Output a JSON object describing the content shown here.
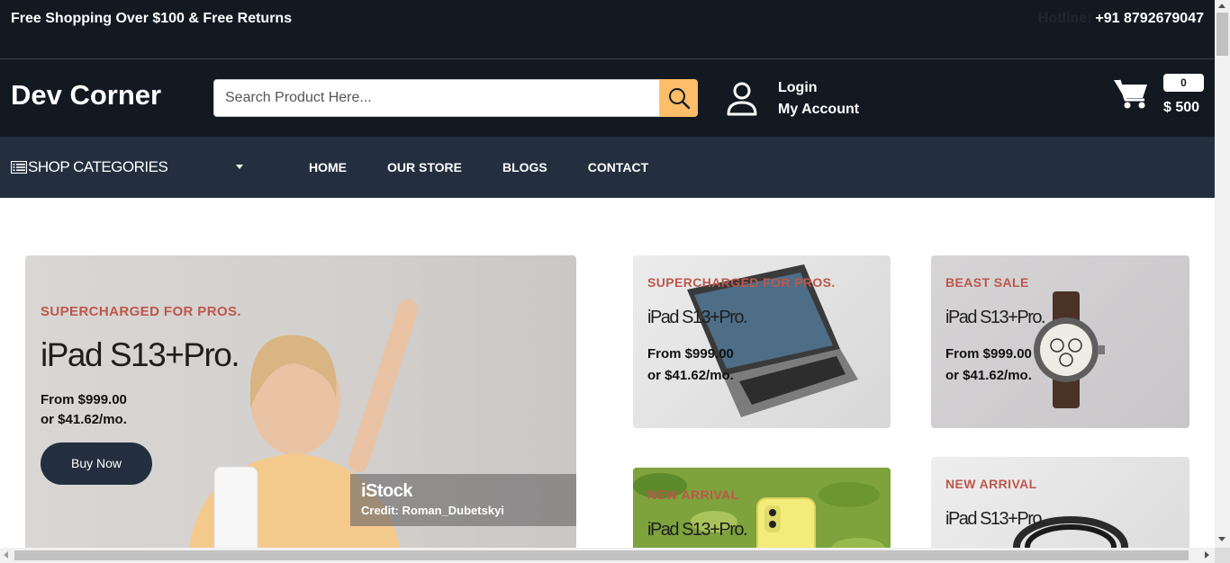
{
  "top_strip": {
    "promo": "Free Shopping Over $100 & Free Returns",
    "hotline_label": "Hotline:",
    "hotline_number": "+91 8792679047"
  },
  "header": {
    "logo": "Dev Corner",
    "search_placeholder": "Search Product Here...",
    "search_icon": "search-icon",
    "login_label": "Login",
    "account_label": "My Account",
    "cart_count": "0",
    "cart_total": "$ 500"
  },
  "nav": {
    "categories_label": "SHOP CATEGORIES",
    "links": [
      "HOME",
      "OUR STORE",
      "BLOGS",
      "CONTACT"
    ]
  },
  "hero": {
    "eyebrow": "SUPERCHARGED FOR PROS.",
    "headline": "iPad S13+Pro.",
    "price_line1": "From $999.00",
    "price_line2": "or $41.62/mo.",
    "cta": "Buy Now",
    "photo_brand": "iStock",
    "photo_credit": "Credit: Roman_Dubetskyi"
  },
  "banners": [
    {
      "eyebrow": "SUPERCHARGED FOR PROS.",
      "headline": "iPad S13+Pro.",
      "price_line1": "From $999.00",
      "price_line2": "or $41.62/mo."
    },
    {
      "eyebrow": "BEAST SALE",
      "headline": "iPad S13+Pro.",
      "price_line1": "From $999.00",
      "price_line2": "or $41.62/mo."
    },
    {
      "eyebrow": "NEW ARRIVAL",
      "headline": "iPad S13+Pro."
    },
    {
      "eyebrow": "NEW ARRIVAL",
      "headline": "iPad S13+Pro."
    }
  ],
  "colors": {
    "header_bg": "#131921",
    "nav_bg": "#232f3e",
    "search_button": "#febd69",
    "eyebrow": "#bc574b"
  }
}
